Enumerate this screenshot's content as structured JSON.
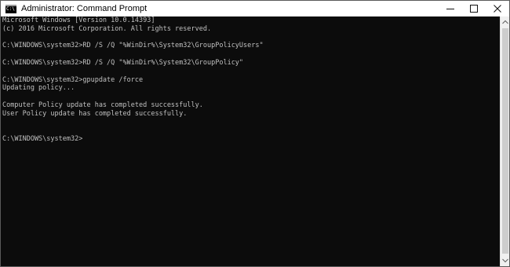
{
  "window": {
    "title": "Administrator: Command Prompt",
    "icon_glyph": "C:\\",
    "controls": {
      "minimize": "minimize-icon",
      "maximize": "maximize-icon",
      "close": "close-icon"
    }
  },
  "console": {
    "lines": [
      "Microsoft Windows [Version 10.0.14393]",
      "(c) 2016 Microsoft Corporation. All rights reserved.",
      "",
      "C:\\WINDOWS\\system32>RD /S /Q \"%WinDir%\\System32\\GroupPolicyUsers\"",
      "",
      "C:\\WINDOWS\\system32>RD /S /Q \"%WinDir%\\System32\\GroupPolicy\"",
      "",
      "C:\\WINDOWS\\system32>gpupdate /force",
      "Updating policy...",
      "",
      "Computer Policy update has completed successfully.",
      "User Policy update has completed successfully.",
      "",
      "",
      "C:\\WINDOWS\\system32>"
    ]
  },
  "colors": {
    "console_bg": "#0c0c0c",
    "console_text": "#c0c0c0",
    "titlebar_bg": "#ffffff"
  }
}
